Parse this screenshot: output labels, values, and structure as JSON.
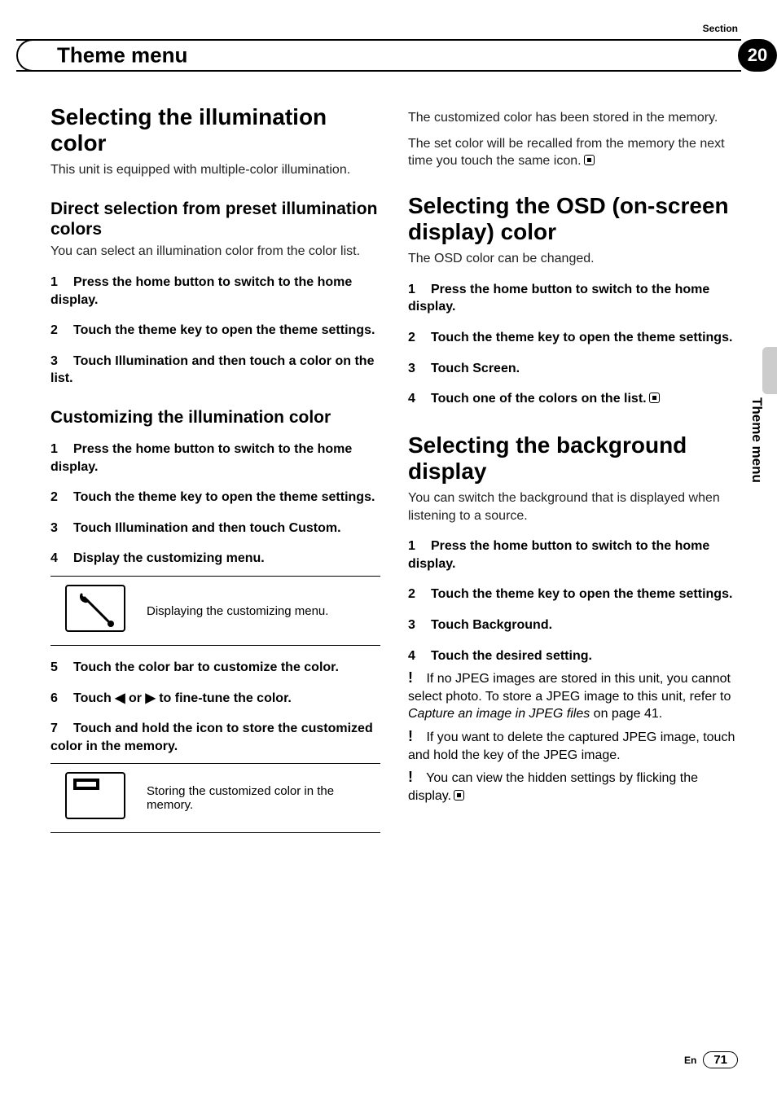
{
  "header": {
    "section_label": "Section",
    "section_number": "20",
    "title": "Theme menu"
  },
  "sidetab": {
    "label": "Theme menu"
  },
  "footer": {
    "lang": "En",
    "page": "71"
  },
  "left": {
    "h1": "Selecting the illumination color",
    "intro": "This unit is equipped with multiple-color illumination.",
    "sub1": {
      "title": "Direct selection from preset illumination colors",
      "intro": "You can select an illumination color from the color list.",
      "steps": [
        {
          "n": "1",
          "text": "Press the home button to switch to the home display."
        },
        {
          "n": "2",
          "text": "Touch the theme key to open the theme settings."
        },
        {
          "n": "3",
          "text": "Touch Illumination and then touch a color on the list."
        }
      ]
    },
    "sub2": {
      "title": "Customizing the illumination color",
      "steps": [
        {
          "n": "1",
          "text": "Press the home button to switch to the home display."
        },
        {
          "n": "2",
          "text": "Touch the theme key to open the theme settings."
        },
        {
          "n": "3",
          "text": "Touch Illumination and then touch Custom."
        },
        {
          "n": "4",
          "text": "Display the customizing menu."
        }
      ],
      "table1_caption": "Displaying the customizing menu.",
      "table1_icon": "wrench-icon",
      "steps2": [
        {
          "n": "5",
          "text": "Touch the color bar to customize the color."
        },
        {
          "n": "6",
          "text": "Touch ◀ or ▶ to fine-tune the color."
        },
        {
          "n": "7",
          "text": "Touch and hold the icon to store the customized color in the memory."
        }
      ],
      "table2_caption": "Storing the customized color in the memory.",
      "table2_icon": "memo-icon"
    }
  },
  "right": {
    "top_para1": "The customized color has been stored in the memory.",
    "top_para2": "The set color will be recalled from the memory the next time you touch the same icon.",
    "sec1": {
      "title": "Selecting the OSD (on-screen display) color",
      "intro": "The OSD color can be changed.",
      "steps": [
        {
          "n": "1",
          "text": "Press the home button to switch to the home display."
        },
        {
          "n": "2",
          "text": "Touch the theme key to open the theme settings."
        },
        {
          "n": "3",
          "text": "Touch Screen."
        },
        {
          "n": "4",
          "text": "Touch one of the colors on the list."
        }
      ]
    },
    "sec2": {
      "title": "Selecting the background display",
      "intro": "You can switch the background that is displayed when listening to a source.",
      "steps": [
        {
          "n": "1",
          "text": "Press the home button to switch to the home display."
        },
        {
          "n": "2",
          "text": "Touch the theme key to open the theme settings."
        },
        {
          "n": "3",
          "text": "Touch Background."
        },
        {
          "n": "4",
          "text": "Touch the desired setting."
        }
      ],
      "bullets": [
        {
          "pre": "If no JPEG images are stored in this unit, you cannot select photo. To store a JPEG image to this unit, refer to ",
          "em": "Capture an image in JPEG files",
          "post": " on page 41."
        },
        {
          "pre": "If you want to delete the captured JPEG image, touch and hold the key of the JPEG image.",
          "em": "",
          "post": ""
        },
        {
          "pre": "You can view the hidden settings by flicking the display.",
          "em": "",
          "post": ""
        }
      ]
    }
  }
}
